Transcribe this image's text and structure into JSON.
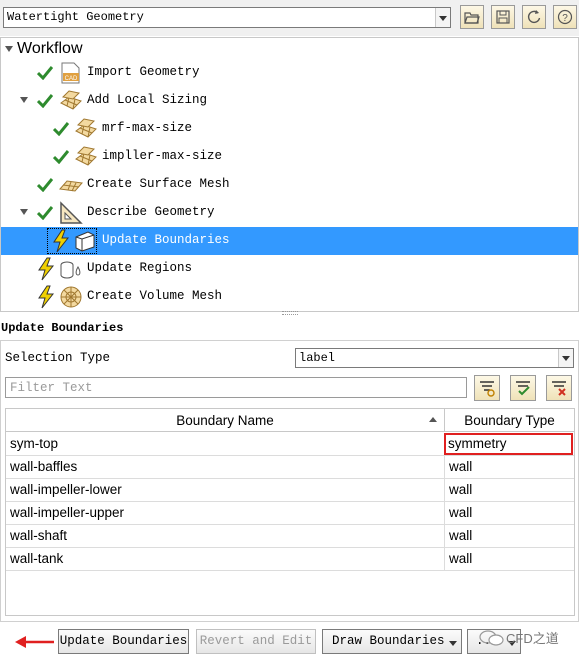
{
  "toolbar": {
    "workflow_select": "Watertight Geometry",
    "icons": [
      "open-folder-icon",
      "save-icon",
      "refresh-icon",
      "help-icon"
    ]
  },
  "tree": {
    "title": "Workflow",
    "items": [
      {
        "label": "Import Geometry",
        "icon": "cad-icon",
        "status": "done"
      },
      {
        "label": "Add Local Sizing",
        "icon": "grid-icon",
        "status": "done",
        "expandable": true
      },
      {
        "label": "mrf-max-size",
        "icon": "grid-icon",
        "status": "done"
      },
      {
        "label": "impller-max-size",
        "icon": "grid-icon",
        "status": "done"
      },
      {
        "label": "Create Surface Mesh",
        "icon": "mesh-icon",
        "status": "done"
      },
      {
        "label": "Describe Geometry",
        "icon": "geometry-icon",
        "status": "done",
        "expandable": true
      },
      {
        "label": "Update Boundaries",
        "icon": "boundary-icon",
        "status": "pending",
        "selected": true
      },
      {
        "label": "Update Regions",
        "icon": "regions-icon",
        "status": "pending"
      },
      {
        "label": "Create Volume Mesh",
        "icon": "volume-mesh-icon",
        "status": "pending"
      }
    ]
  },
  "section": {
    "title": "Update Boundaries",
    "selection_type_label": "Selection Type",
    "selection_type_value": "label",
    "filter_placeholder": "Filter Text"
  },
  "table": {
    "headers": [
      "Boundary Name",
      "Boundary Type"
    ],
    "rows": [
      [
        "sym-top",
        "symmetry"
      ],
      [
        "wall-baffles",
        "wall"
      ],
      [
        "wall-impeller-lower",
        "wall"
      ],
      [
        "wall-impeller-upper",
        "wall"
      ],
      [
        "wall-shaft",
        "wall"
      ],
      [
        "wall-tank",
        "wall"
      ]
    ]
  },
  "buttons": {
    "update": "Update Boundaries",
    "revert": "Revert and Edit",
    "draw": "Draw Boundaries",
    "more": "..."
  },
  "watermark": "CFD之道",
  "colors": {
    "selection": "#3399ff",
    "check": "#2e8b2e",
    "lightning": "#f0d000",
    "highlight_border": "#e02020",
    "annotation_arrow": "#e02020"
  }
}
